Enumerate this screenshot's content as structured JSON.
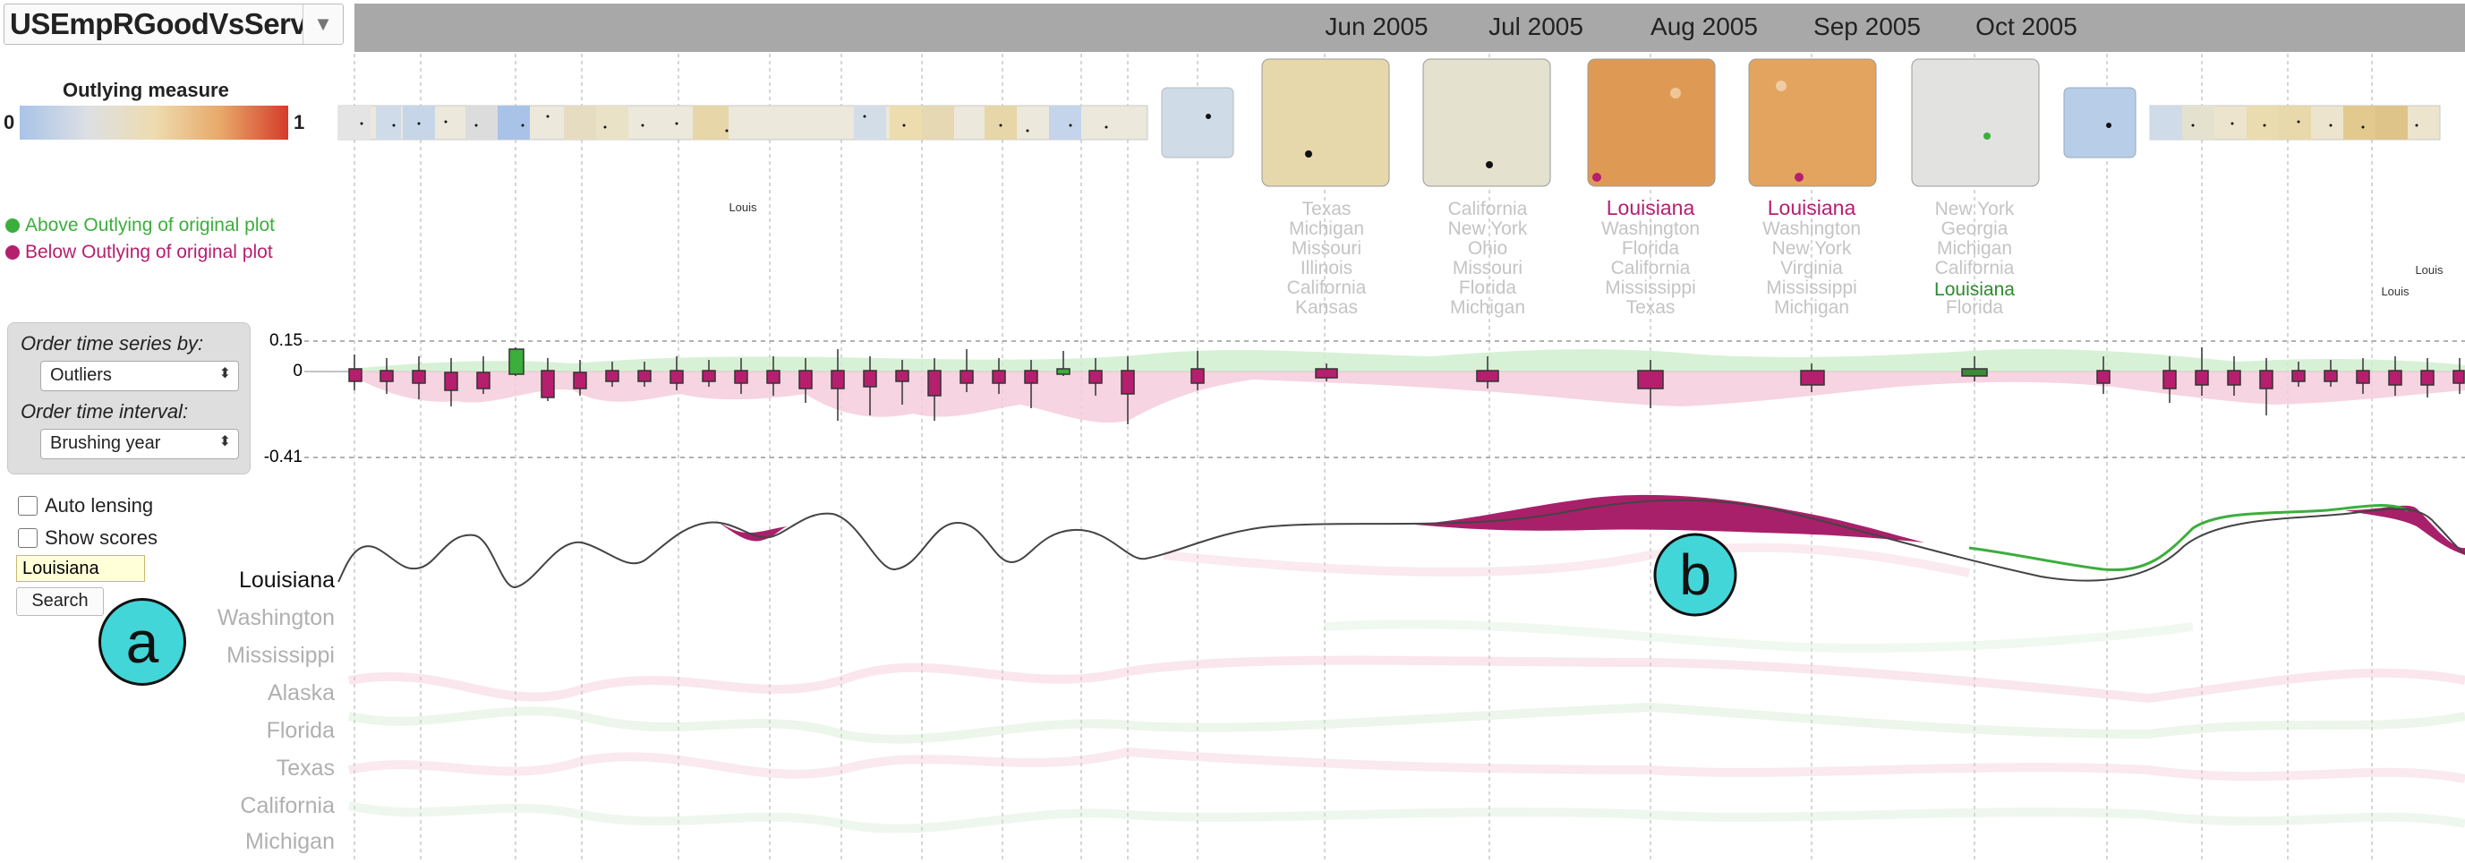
{
  "dataset": {
    "label": "USEmpRGoodVsService",
    "arrow_icon": "triangle-down"
  },
  "timeline": {
    "months": [
      "Jun 2005",
      "Jul 2005",
      "Aug 2005",
      "Sep 2005",
      "Oct 2005"
    ]
  },
  "legend": {
    "title": "Outlying measure",
    "min": "0",
    "max": "1",
    "above_label": "Above Outlying of original plot",
    "below_label": "Below Outlying of original plot",
    "above_color": "#3cae3c",
    "below_color": "#b51f6e"
  },
  "thumbnails": {
    "large": [
      {
        "color": "#e6d8aa",
        "names": [
          "Texas",
          "Michigan",
          "Missouri",
          "Illinois",
          "California",
          "Kansas"
        ]
      },
      {
        "color": "#e4e1cf",
        "names": [
          "California",
          "New York",
          "Ohio",
          "Missouri",
          "Florida",
          "Michigan"
        ]
      },
      {
        "color": "#de9a55",
        "highlight": "Louisiana",
        "names": [
          "Washington",
          "Florida",
          "California",
          "Mississippi",
          "Texas"
        ]
      },
      {
        "color": "#e2a45e",
        "highlight": "Louisiana",
        "names": [
          "Washington",
          "New York",
          "Virginia",
          "Mississippi",
          "Michigan"
        ]
      },
      {
        "color": "#e2e2e0",
        "names": [
          "New York",
          "Georgia",
          "Michigan",
          "California",
          "Florida"
        ],
        "highlight_below": "Louisiana"
      }
    ],
    "small_label": "Louis"
  },
  "boxplot_axis": {
    "top": "0.15",
    "zero": "0",
    "bottom": "-0.41"
  },
  "order_panel": {
    "series_label": "Order time series by:",
    "series_value": "Outliers",
    "interval_label": "Order time interval:",
    "interval_value": "Brushing year"
  },
  "options": {
    "auto_lensing": "Auto lensing",
    "show_scores": "Show scores"
  },
  "search": {
    "value": "Louisiana",
    "button": "Search"
  },
  "states": [
    "Louisiana",
    "Washington",
    "Mississippi",
    "Alaska",
    "Florida",
    "Texas",
    "California",
    "Michigan"
  ],
  "markers": {
    "a": "a",
    "b": "b"
  }
}
